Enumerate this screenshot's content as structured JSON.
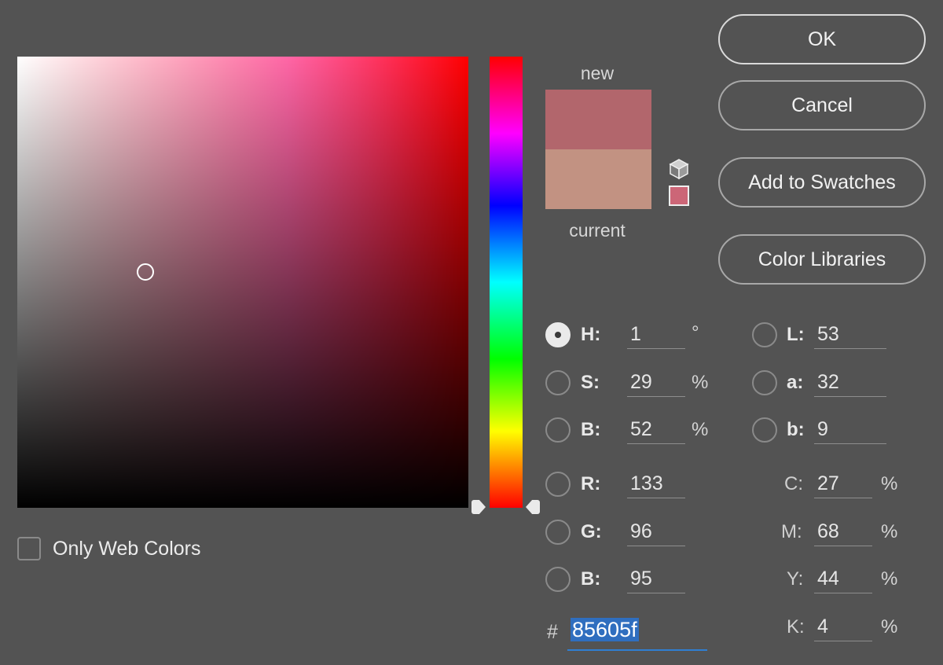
{
  "colors": {
    "new": "#b2666c",
    "current": "#c29282",
    "websafe": "#cc6677",
    "hex_selection": "#2f6ebf"
  },
  "picker": {
    "field_icon": "saturation-brightness-field",
    "hue_icon": "hue-slider"
  },
  "swatch": {
    "new_label": "new",
    "current_label": "current"
  },
  "buttons": {
    "ok": "OK",
    "cancel": "Cancel",
    "add_to_swatches": "Add to Swatches",
    "color_libraries": "Color Libraries"
  },
  "hsb": {
    "h": {
      "label": "H:",
      "value": "1",
      "unit": "°",
      "selected": true
    },
    "s": {
      "label": "S:",
      "value": "29",
      "unit": "%"
    },
    "b": {
      "label": "B:",
      "value": "52",
      "unit": "%"
    }
  },
  "rgb": {
    "r": {
      "label": "R:",
      "value": "133"
    },
    "g": {
      "label": "G:",
      "value": "96"
    },
    "b": {
      "label": "B:",
      "value": "95"
    }
  },
  "lab": {
    "l": {
      "label": "L:",
      "value": "53"
    },
    "a": {
      "label": "a:",
      "value": "32"
    },
    "b": {
      "label": "b:",
      "value": "9"
    }
  },
  "cmyk": {
    "c": {
      "label": "C:",
      "value": "27",
      "unit": "%"
    },
    "m": {
      "label": "M:",
      "value": "68",
      "unit": "%"
    },
    "y": {
      "label": "Y:",
      "value": "44",
      "unit": "%"
    },
    "k": {
      "label": "K:",
      "value": "4",
      "unit": "%"
    }
  },
  "hex": {
    "hash": "#",
    "value": "85605f"
  },
  "web_colors": {
    "label": "Only Web Colors",
    "checked": false
  }
}
